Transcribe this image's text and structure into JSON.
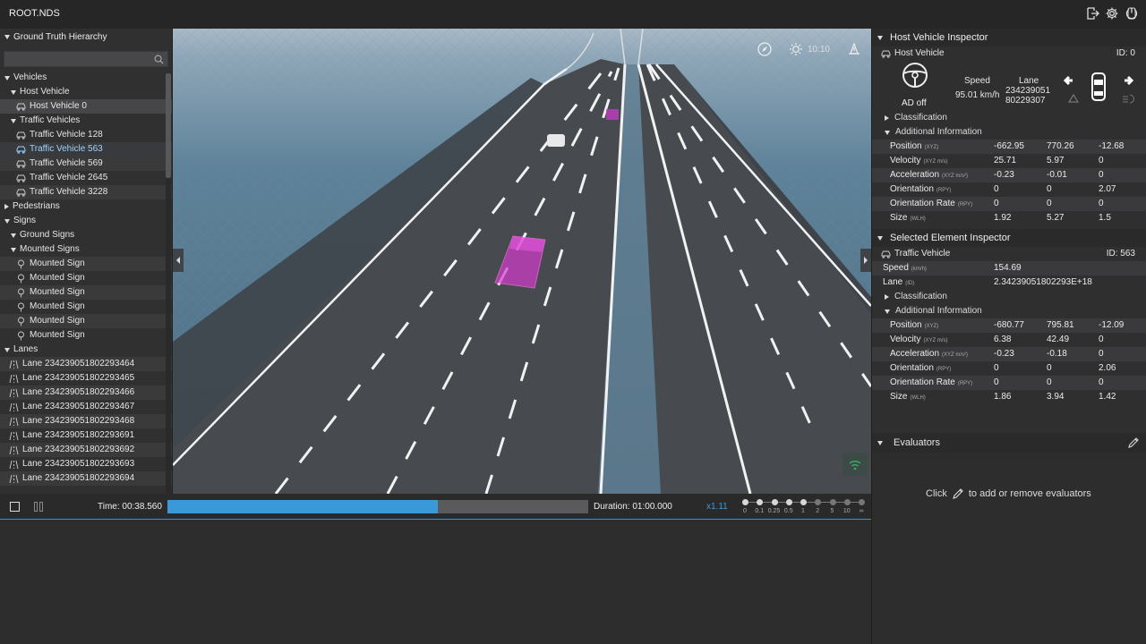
{
  "app": {
    "title": "ROOT.NDS"
  },
  "hierarchy": {
    "title": "Ground Truth Hierarchy",
    "search_placeholder": "",
    "vehicles_label": "Vehicles",
    "host_vehicle_group": "Host Vehicle",
    "host_vehicle_item": "Host Vehicle 0",
    "traffic_group": "Traffic Vehicles",
    "traffic_items": [
      "Traffic Vehicle 128",
      "Traffic Vehicle 563",
      "Traffic Vehicle 569",
      "Traffic Vehicle 2645",
      "Traffic Vehicle 3228"
    ],
    "pedestrians_label": "Pedestrians",
    "signs_label": "Signs",
    "ground_signs_label": "Ground Signs",
    "mounted_signs_label": "Mounted Signs",
    "mounted_items": [
      "Mounted Sign",
      "Mounted Sign",
      "Mounted Sign",
      "Mounted Sign",
      "Mounted Sign",
      "Mounted Sign"
    ],
    "lanes_label": "Lanes",
    "lane_items": [
      "Lane 234239051802293464",
      "Lane 234239051802293465",
      "Lane 234239051802293466",
      "Lane 234239051802293467",
      "Lane 234239051802293468",
      "Lane 234239051802293691",
      "Lane 234239051802293692",
      "Lane 234239051802293693",
      "Lane 234239051802293694"
    ]
  },
  "viewport": {
    "clock": "10:10"
  },
  "timeline": {
    "time": "Time: 00:38.560",
    "duration": "Duration: 01:00.000",
    "speed": "x1.11",
    "progress_percent": 64.3,
    "speed_labels": [
      "0",
      "0.1",
      "0.25",
      "0.5",
      "1",
      "2",
      "5",
      "10",
      "∞"
    ],
    "selected_speed_index": 4,
    "accent_color": "#3a9ad9"
  },
  "host_inspector": {
    "title": "Host Vehicle Inspector",
    "subtitle": "Host Vehicle",
    "id": "ID: 0",
    "ad_label": "AD off",
    "speed_header": "Speed",
    "speed_value": "95.01 km/h",
    "lane_header": "Lane",
    "lane_value_1": "234239051",
    "lane_value_2": "80229307",
    "classification": "Classification",
    "additional": "Additional Information",
    "rows": [
      {
        "key": "Position",
        "unit": "(XYZ)",
        "v": [
          "-662.95",
          "770.26",
          "-12.68"
        ]
      },
      {
        "key": "Velocity",
        "unit": "(XYZ m/s)",
        "v": [
          "25.71",
          "5.97",
          "0"
        ]
      },
      {
        "key": "Acceleration",
        "unit": "(XYZ m/s²)",
        "v": [
          "-0.23",
          "-0.01",
          "0"
        ]
      },
      {
        "key": "Orientation",
        "unit": "(RPY)",
        "v": [
          "0",
          "0",
          "2.07"
        ]
      },
      {
        "key": "Orientation Rate",
        "unit": "(RPY)",
        "v": [
          "0",
          "0",
          "0"
        ]
      },
      {
        "key": "Size",
        "unit": "(WLH)",
        "v": [
          "1.92",
          "5.27",
          "1.5"
        ]
      }
    ]
  },
  "selected_inspector": {
    "title": "Selected Element Inspector",
    "subtitle": "Traffic Vehicle",
    "id": "ID: 563",
    "speed_key": "Speed",
    "speed_unit": "(km/h)",
    "speed_value": "154.69",
    "lane_key": "Lane",
    "lane_unit": "(ID)",
    "lane_value": "2.34239051802293E+18",
    "classification": "Classification",
    "additional": "Additional Information",
    "rows": [
      {
        "key": "Position",
        "unit": "(XYZ)",
        "v": [
          "-680.77",
          "795.81",
          "-12.09"
        ]
      },
      {
        "key": "Velocity",
        "unit": "(XYZ m/s)",
        "v": [
          "6.38",
          "42.49",
          "0"
        ]
      },
      {
        "key": "Acceleration",
        "unit": "(XYZ m/s²)",
        "v": [
          "-0.23",
          "-0.18",
          "0"
        ]
      },
      {
        "key": "Orientation",
        "unit": "(RPY)",
        "v": [
          "0",
          "0",
          "2.06"
        ]
      },
      {
        "key": "Orientation Rate",
        "unit": "(RPY)",
        "v": [
          "0",
          "0",
          "0"
        ]
      },
      {
        "key": "Size",
        "unit": "(WLH)",
        "v": [
          "1.86",
          "3.94",
          "1.42"
        ]
      }
    ]
  },
  "evaluators": {
    "title": "Evaluators",
    "hint_pre": "Click",
    "hint_post": "to add or remove evaluators"
  }
}
